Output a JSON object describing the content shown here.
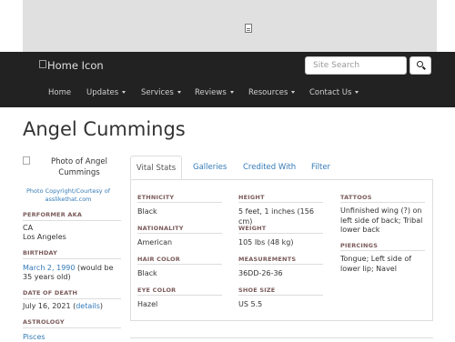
{
  "header": {
    "logo_alt": "Home Icon",
    "search_placeholder": "Site Search"
  },
  "nav": {
    "items": [
      {
        "label": "Home",
        "dropdown": false
      },
      {
        "label": "Updates",
        "dropdown": true
      },
      {
        "label": "Services",
        "dropdown": true
      },
      {
        "label": "Reviews",
        "dropdown": true
      },
      {
        "label": "Resources",
        "dropdown": true
      },
      {
        "label": "Contact Us",
        "dropdown": true
      }
    ]
  },
  "page": {
    "title": "Angel Cummings"
  },
  "sidebar": {
    "photo_alt": "Photo of Angel Cummings",
    "photo_credit": "Photo Copyright/Courtesy of asslikethat.com",
    "performer_aka_label": "PERFORMER AKA",
    "performer_aka": [
      "CA",
      "Los Angeles"
    ],
    "birthday_label": "BIRTHDAY",
    "birthday_date": "March 2, 1990",
    "birthday_age": " (would be 35 years old)",
    "death_label": "DATE OF DEATH",
    "death_date": "July 16, 2021 (",
    "death_details_link": "details",
    "death_close": ")",
    "astrology_label": "ASTROLOGY",
    "astrology": "Pisces"
  },
  "tabs": [
    "Vital Stats",
    "Galleries",
    "Credited With",
    "Filter"
  ],
  "vitals": {
    "col1": [
      {
        "label": "ETHNICITY",
        "value": "Black"
      },
      {
        "label": "NATIONALITY",
        "value": "American"
      },
      {
        "label": "HAIR COLOR",
        "value": "Black"
      },
      {
        "label": "EYE COLOR",
        "value": "Hazel"
      }
    ],
    "col2": [
      {
        "label": "HEIGHT",
        "value": "5 feet, 1 inches (156 cm)"
      },
      {
        "label": "WEIGHT",
        "value": "105 lbs (48 kg)"
      },
      {
        "label": "MEASUREMENTS",
        "value": "36DD-26-36"
      },
      {
        "label": "SHOE SIZE",
        "value": "US 5.5"
      }
    ],
    "col3": [
      {
        "label": "TATTOOS",
        "value": "Unfinished wing (?) on left side of back; Tribal lower back"
      },
      {
        "label": "PIERCINGS",
        "value": "Tongue; Left side of lower lip; Navel"
      }
    ]
  }
}
